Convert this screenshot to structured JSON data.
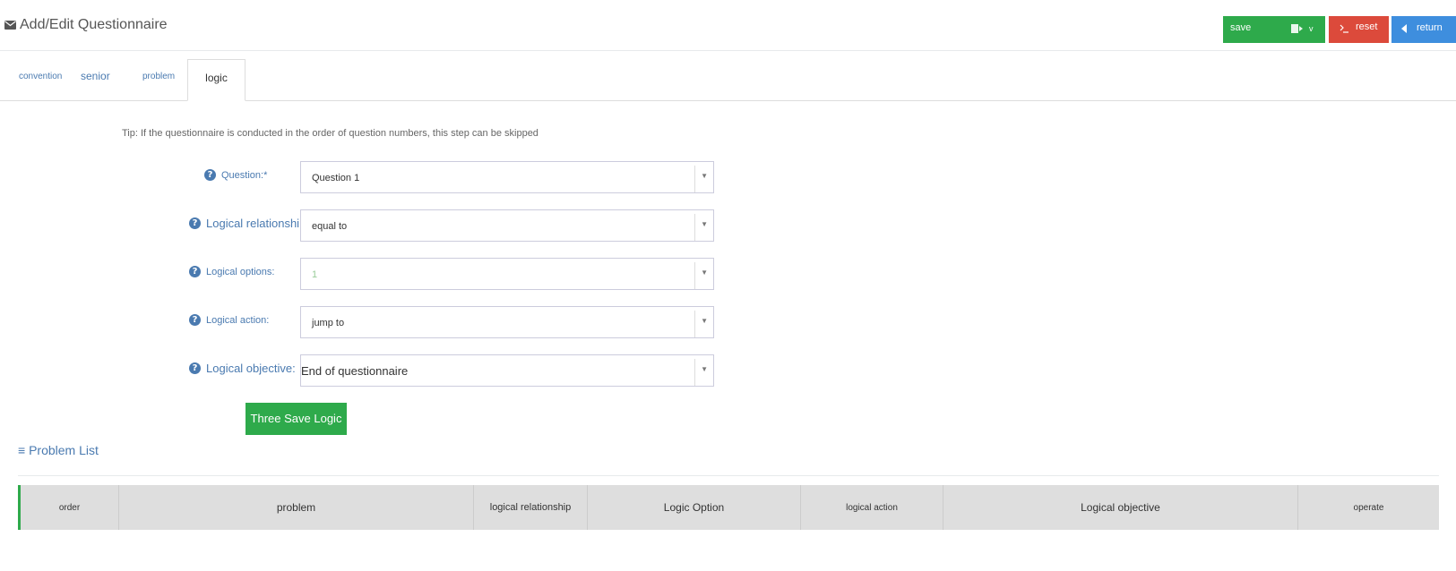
{
  "header": {
    "title": "Add/Edit Questionnaire",
    "buttons": {
      "save": "save",
      "save_extra": "v",
      "reset": "reset",
      "return": "return"
    }
  },
  "tabs": [
    "convention",
    "senior",
    "problem",
    "logic"
  ],
  "tip": "Tip: If the questionnaire is conducted in the order of question numbers, this step can be skipped",
  "form": {
    "question": {
      "label": "Question:*",
      "value": "Question 1"
    },
    "relationship": {
      "label": "Logical relationship:",
      "value": "equal to"
    },
    "options": {
      "label": "Logical options:",
      "value": "1"
    },
    "action": {
      "label": "Logical action:",
      "value": "jump to"
    },
    "objective": {
      "label": "Logical objective:",
      "value": "End of questionnaire"
    }
  },
  "save_logic_label": "Three Save Logic",
  "problem_list": {
    "title": "Problem List",
    "columns": [
      "order",
      "problem",
      "logical relationship",
      "Logic Option",
      "logical action",
      "Logical objective",
      "operate"
    ]
  },
  "colors": {
    "green": "#2eaa4b",
    "red": "#dc4a3b",
    "blue": "#3e8ede",
    "link": "#4a7ab0"
  },
  "icons": [
    "envelope-icon",
    "export-icon",
    "reset-icon",
    "return-icon",
    "help-icon",
    "dropdown-arrow-icon",
    "list-icon"
  ]
}
